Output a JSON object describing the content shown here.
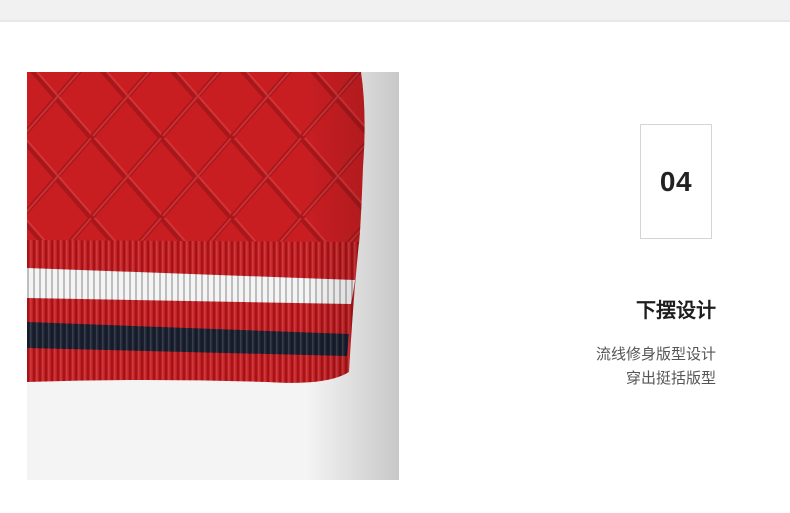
{
  "section": {
    "number": "04",
    "title": "下摆设计",
    "description_lines": [
      "流线修身版型设计",
      "穿出挺括版型"
    ]
  },
  "colors": {
    "knit_red": "#c81e22",
    "stripe_white": "#f4f4f4",
    "stripe_navy": "#1c2233",
    "background": "#ffffff",
    "top_band": "#f1f1f1"
  }
}
